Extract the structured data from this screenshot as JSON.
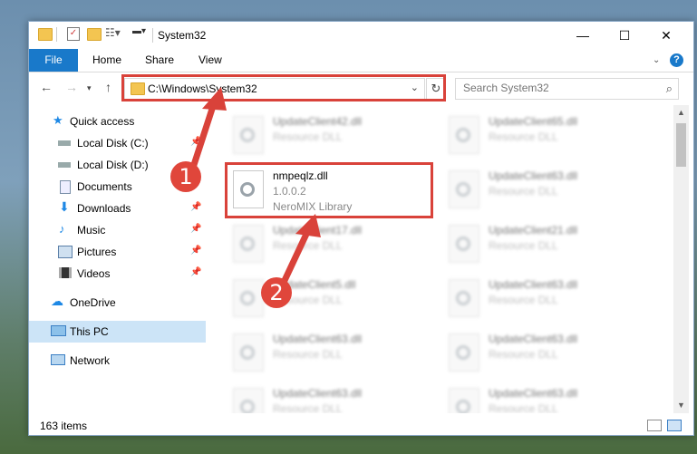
{
  "window": {
    "title": "System32",
    "controls": {
      "minimize": "—",
      "maximize": "☐",
      "close": "✕"
    }
  },
  "ribbon": {
    "file": "File",
    "tabs": [
      "Home",
      "Share",
      "View"
    ],
    "help": "?"
  },
  "nav": {
    "address": "C:\\Windows\\System32",
    "search_placeholder": "Search System32"
  },
  "sidebar": {
    "items": [
      {
        "label": "Quick access",
        "icon": "star-icon"
      },
      {
        "label": "Local Disk (C:)",
        "icon": "drive-icon"
      },
      {
        "label": "Local Disk (D:)",
        "icon": "drive-icon"
      },
      {
        "label": "Documents",
        "icon": "documents-icon"
      },
      {
        "label": "Downloads",
        "icon": "download-icon"
      },
      {
        "label": "Music",
        "icon": "music-icon"
      },
      {
        "label": "Pictures",
        "icon": "pictures-icon"
      },
      {
        "label": "Videos",
        "icon": "videos-icon"
      },
      {
        "label": "OneDrive",
        "icon": "cloud-icon"
      },
      {
        "label": "This PC",
        "icon": "computer-icon"
      },
      {
        "label": "Network",
        "icon": "network-icon"
      }
    ]
  },
  "files": [
    {
      "name": "UpdateClient42.dll",
      "type": "Resource DLL"
    },
    {
      "name": "UpdateClient65.dll",
      "type": "Resource DLL"
    },
    {
      "name": "nmpeqlz.dll",
      "version": "1.0.0.2",
      "type": "NeroMIX Library"
    },
    {
      "name": "UpdateClient63.dll",
      "type": "Resource DLL"
    },
    {
      "name": "UpdateClient17.dll",
      "type": "Resource DLL"
    },
    {
      "name": "UpdateClient21.dll",
      "type": "Resource DLL"
    },
    {
      "name": "UpdateClient5.dll",
      "type": "Resource DLL"
    },
    {
      "name": "UpdateClient63.dll",
      "type": "Resource DLL"
    },
    {
      "name": "UpdateClient63.dll",
      "type": "Resource DLL"
    },
    {
      "name": "UpdateClient63.dll",
      "type": "Resource DLL"
    },
    {
      "name": "UpdateClient63.dll",
      "type": "Resource DLL"
    },
    {
      "name": "UpdateClient63.dll",
      "type": "Resource DLL"
    }
  ],
  "status": {
    "item_count": "163 items"
  },
  "annotations": {
    "step1": "1",
    "step2": "2",
    "color": "#d9423a"
  }
}
